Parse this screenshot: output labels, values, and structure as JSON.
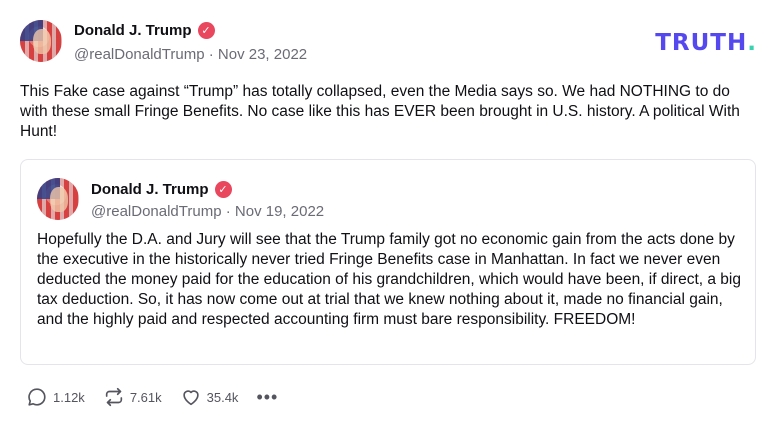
{
  "logo": {
    "text": "TRUTH",
    "dot": "."
  },
  "post": {
    "author": {
      "display_name": "Donald J. Trump",
      "verified_mark": "✓",
      "handle": "@realDonaldTrump",
      "separator": " · ",
      "date": "Nov 23, 2022"
    },
    "text": "This Fake case against “Trump” has totally collapsed, even the Media says so. We had NOTHING to do with these small Fringe Benefits. No case like this has EVER been brought in U.S. history. A political With Hunt!"
  },
  "quoted_post": {
    "author": {
      "display_name": "Donald J. Trump",
      "verified_mark": "✓",
      "handle": "@realDonaldTrump",
      "separator": " · ",
      "date": "Nov 19, 2022"
    },
    "text": "Hopefully the D.A. and Jury will see that the Trump family got no economic gain from the acts done by the executive in the historically never tried Fringe Benefits case in Manhattan. In fact we never even deducted the money paid for the education of his grandchildren, which would have been, if direct, a big tax deduction. So, it has now come out at trial that we knew nothing about it, made no financial gain, and the highly paid and respected accounting firm must bare responsibility. FREEDOM!"
  },
  "actions": {
    "replies": "1.12k",
    "retruths": "7.61k",
    "likes": "35.4k",
    "more": "•••"
  },
  "colors": {
    "logo": "#5448ee",
    "logo_dot": "#3ad1b0",
    "verified": "#e8475e",
    "muted": "#6b6b76",
    "border": "#e4e4ea"
  }
}
